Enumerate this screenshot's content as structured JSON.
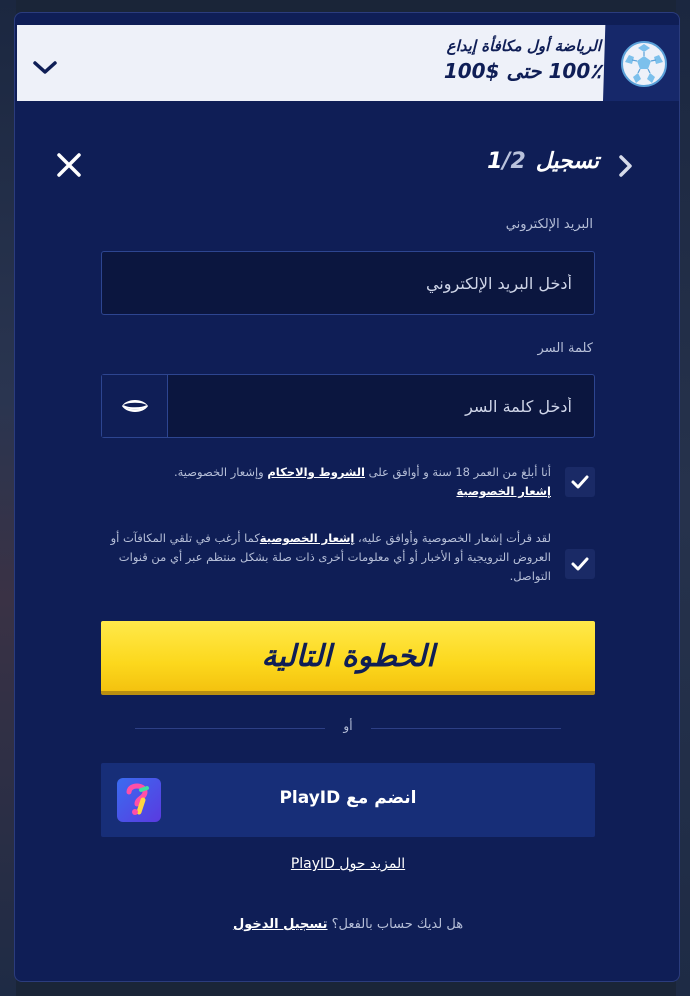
{
  "promo": {
    "line1": "الرياضة أول مكافأة إيداع",
    "line2": "100٪ حتى $100",
    "icon": "football-icon",
    "toggle_icon": "chevron-down-icon"
  },
  "header": {
    "title": "تسجيل",
    "step_current": "1",
    "step_total": "/2",
    "close_icon": "close-icon",
    "back_icon": "chevron-right-icon"
  },
  "form": {
    "email_label": "البريد الإلكتروني",
    "email_placeholder": "أدخل البريد الإلكتروني",
    "email_value": "",
    "password_label": "كلمة السر",
    "password_placeholder": "أدخل كلمة السر",
    "password_value": "",
    "show_password_icon": "eye-icon"
  },
  "consent": {
    "age": {
      "checked": true,
      "text_before": "أنا أبلغ من العمر 18 سنة و أوافق على ",
      "terms_link": "الشروط والاحكام",
      "text_after": " وإشعار الخصوصية.",
      "privacy_link": "إشعار الخصوصية"
    },
    "marketing": {
      "checked": true,
      "text_before": "لقد قرأت إشعار الخصوصية وأوافق عليه، ",
      "privacy_link": "إشعار الخصوصية",
      "text_after": "كما أرغب في تلقي المكافآت أو العروض الترويجية أو الأخبار أو أي معلومات أخرى ذات صلة بشكل منتظم عبر أي من قنوات التواصل."
    }
  },
  "actions": {
    "next_label": "الخطوة التالية",
    "or_label": "أو",
    "playid_label": "انضم مع PlayID",
    "playid_more": "المزيد حول PlayID",
    "login_prompt": "هل لديك حساب بالفعل؟ ",
    "login_link": "تسجيل الدخول"
  },
  "colors": {
    "panel": "#0f1e56",
    "accent_yellow": "#fcd81d",
    "playid_button": "#172e78"
  }
}
